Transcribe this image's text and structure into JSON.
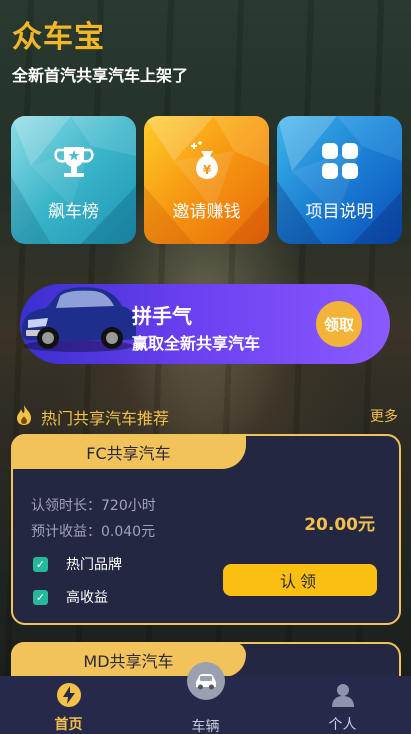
{
  "header": {
    "brand": "众车宝",
    "tagline": "全新首汽共享汽车上架了"
  },
  "tiles": [
    {
      "label": "飙车榜",
      "icon": "trophy-icon"
    },
    {
      "label": "邀请赚钱",
      "icon": "money-bag-icon"
    },
    {
      "label": "项目说明",
      "icon": "grid-icon"
    }
  ],
  "banner": {
    "title": "拼手气",
    "subtitle": "赢取全新共享汽车",
    "button": "领取",
    "icon": "car-icon"
  },
  "section": {
    "title": "热门共享汽车推荐",
    "more": "更多",
    "icon": "fire-icon"
  },
  "cards": [
    {
      "name": "FC共享汽车",
      "duration": "认领时长：720小时",
      "earnings": "预计收益：0.040元",
      "price": "20.00元",
      "features": [
        "热门品牌",
        "高收益"
      ],
      "button": "认领"
    },
    {
      "name": "MD共享汽车"
    }
  ],
  "tabbar": [
    {
      "label": "首页",
      "icon": "lightning-icon",
      "active": true
    },
    {
      "label": "车辆",
      "icon": "car-icon",
      "active": false
    },
    {
      "label": "个人",
      "icon": "user-icon",
      "active": false
    }
  ],
  "colors": {
    "accent": "#f3b629",
    "card_bg": "#232741",
    "tabbar_bg": "#262a4a",
    "check": "#26b89a",
    "button": "#fbbf12"
  }
}
